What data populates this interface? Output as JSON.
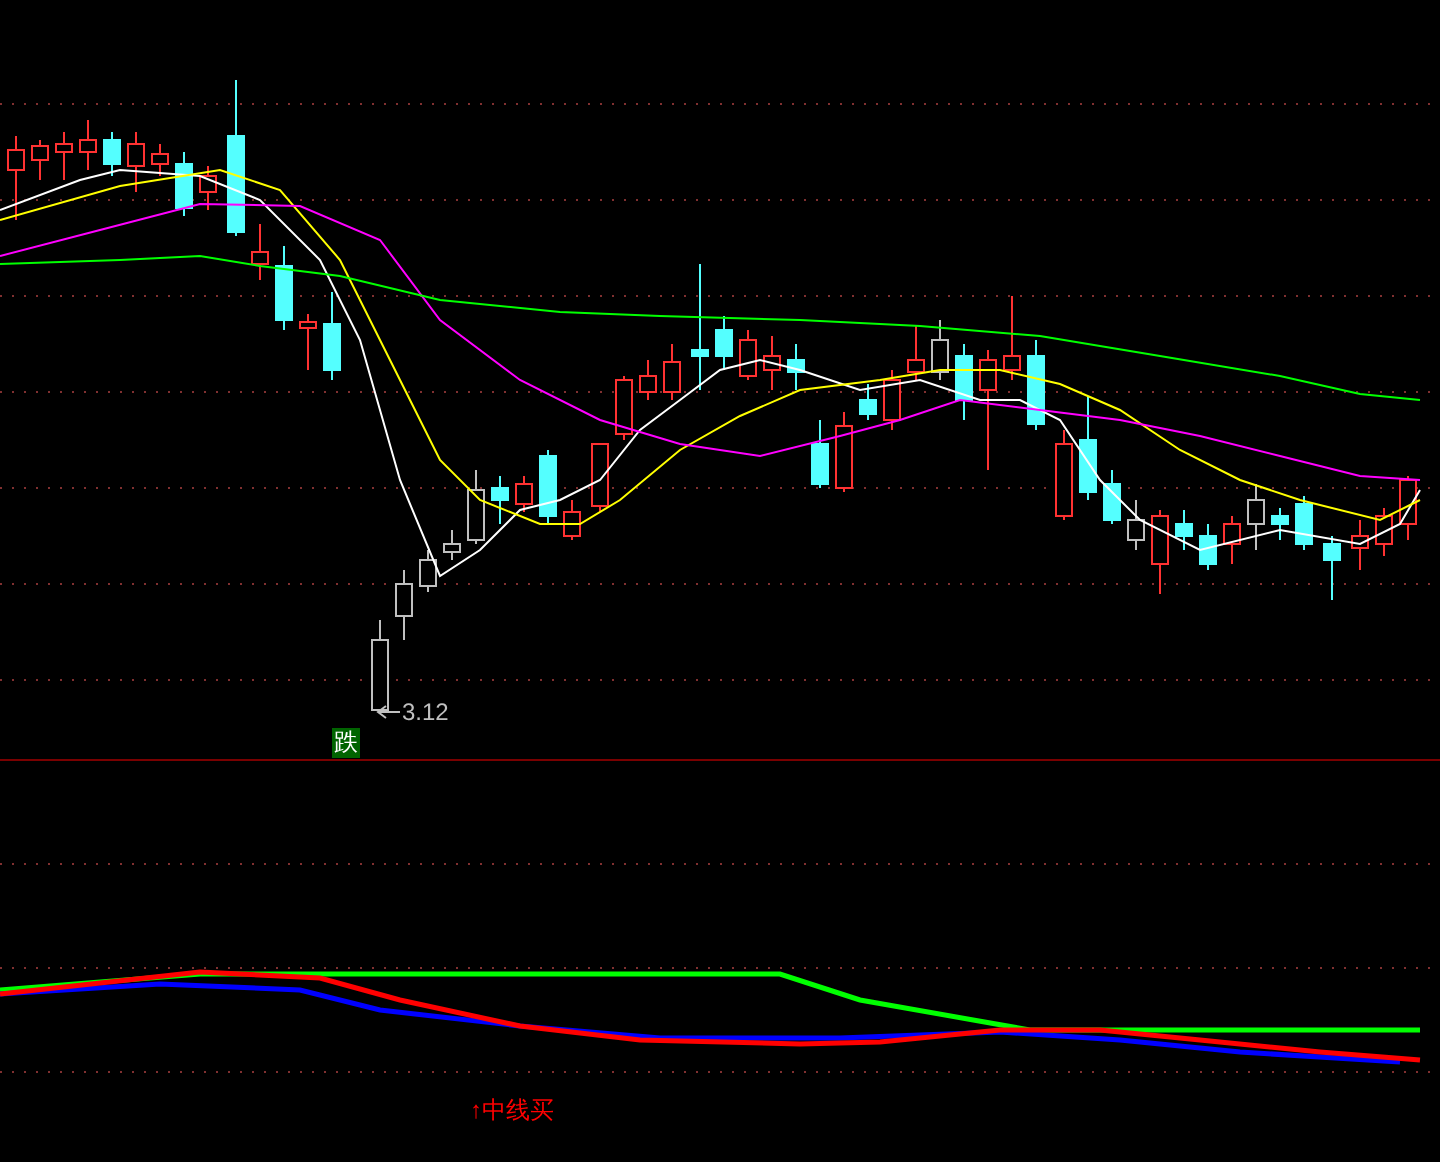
{
  "price_panel": {
    "low_marker": "3.12",
    "signal_badge": "跌"
  },
  "indicator_panel": {
    "signal_label": "↑中线买"
  }
}
